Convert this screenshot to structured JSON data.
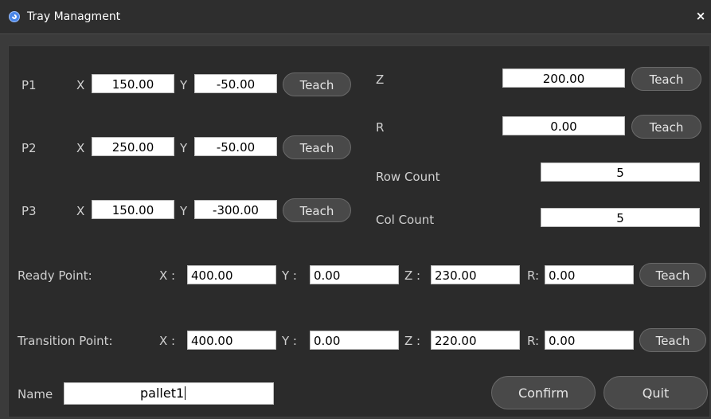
{
  "window": {
    "title": "Tray  Managment",
    "close": "×"
  },
  "points": [
    {
      "label": "P1",
      "x_label": "X",
      "x": "150.00",
      "y_label": "Y",
      "y": "-50.00",
      "teach": "Teach"
    },
    {
      "label": "P2",
      "x_label": "X",
      "x": "250.00",
      "y_label": "Y",
      "y": "-50.00",
      "teach": "Teach"
    },
    {
      "label": "P3",
      "x_label": "X",
      "x": "150.00",
      "y_label": "Y",
      "y": "-300.00",
      "teach": "Teach"
    }
  ],
  "z": {
    "label": "Z",
    "value": "200.00",
    "teach": "Teach"
  },
  "r": {
    "label": "R",
    "value": "0.00",
    "teach": "Teach"
  },
  "row_count": {
    "label": "Row Count",
    "value": "5"
  },
  "col_count": {
    "label": "Col Count",
    "value": "5"
  },
  "ready_point": {
    "label": "Ready Point:",
    "x_label": "X :",
    "x": "400.00",
    "y_label": "Y :",
    "y": "0.00",
    "z_label": "Z :",
    "z": "230.00",
    "r_label": "R:",
    "r": "0.00",
    "teach": "Teach"
  },
  "transition_point": {
    "label": "Transition Point:",
    "x_label": "X :",
    "x": "400.00",
    "y_label": "Y :",
    "y": "0.00",
    "z_label": "Z :",
    "z": "220.00",
    "r_label": "R:",
    "r": "0.00",
    "teach": "Teach"
  },
  "name": {
    "label": "Name",
    "value": "pallet1"
  },
  "buttons": {
    "confirm": "Confirm",
    "quit": "Quit"
  }
}
